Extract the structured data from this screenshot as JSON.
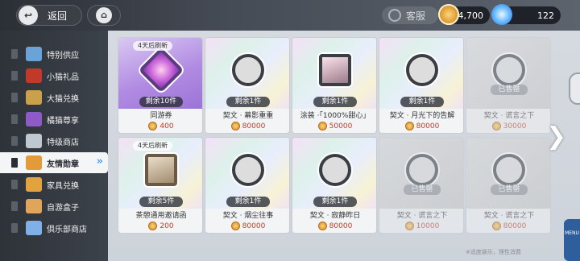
{
  "topbar": {
    "back_label": "返回",
    "service_label": "客服",
    "coins": "24,700",
    "gems": "122"
  },
  "sidebar": {
    "items": [
      {
        "label": "特别供应",
        "icon": "syringe-icon",
        "color": "#6aa3d8"
      },
      {
        "label": "小猫礼品",
        "icon": "ticket-icon",
        "color": "#c0392b"
      },
      {
        "label": "大猫兑换",
        "icon": "gold-ticket-icon",
        "color": "#caa04a"
      },
      {
        "label": "橘猫尊享",
        "icon": "purple-ticket-icon",
        "color": "#8e5ac8"
      },
      {
        "label": "特级商店",
        "icon": "diamond-icon",
        "color": "#bfc7d0"
      },
      {
        "label": "友情勋章",
        "icon": "medal-icon",
        "color": "#e39b3a",
        "active": true
      },
      {
        "label": "家具兑换",
        "icon": "coin-icon",
        "color": "#e2a33e"
      },
      {
        "label": "自游盒子",
        "icon": "box-icon",
        "color": "#e0a45a"
      },
      {
        "label": "俱乐部商店",
        "icon": "club-coin-icon",
        "color": "#7fb1e6"
      }
    ]
  },
  "shop": {
    "cards": [
      {
        "name": "同游券",
        "price": "400",
        "remain": "剩余10件",
        "refresh": "4天后刷新",
        "style": "purple",
        "icon": "heart-ticket-icon"
      },
      {
        "name": "契文 · 幕影重重",
        "price": "80000",
        "remain": "剩余1件",
        "style": "holo",
        "icon": "emblem-icon"
      },
      {
        "name": "涂装 ·「1000%甜心」",
        "price": "50000",
        "remain": "剩余1件",
        "style": "holo",
        "icon": "photo-cards-icon"
      },
      {
        "name": "契文 · 月光下的告解",
        "price": "80000",
        "remain": "剩余1件",
        "style": "holo",
        "icon": "emblem-icon"
      },
      {
        "name": "契文 · 谎言之下",
        "price": "30000",
        "sold": "已售罄",
        "style": "grey",
        "icon": "sleep-emblem-icon"
      },
      {
        "name": "茶憩通用邀请函",
        "price": "200",
        "remain": "剩余5件",
        "refresh": "4天后刷新",
        "style": "holo",
        "icon": "envelope-icon"
      },
      {
        "name": "契文 · 烟尘往事",
        "price": "80000",
        "remain": "剩余1件",
        "style": "holo",
        "icon": "emblem-icon"
      },
      {
        "name": "契文 · 寂静昨日",
        "price": "80000",
        "remain": "剩余1件",
        "style": "holo",
        "icon": "emblem-icon"
      },
      {
        "name": "契文 · 谎言之下",
        "price": "10000",
        "sold": "已售罄",
        "style": "grey",
        "icon": "sleep-emblem-icon"
      },
      {
        "name": "契文 · 谎言之下",
        "price": "80000",
        "sold": "已售罄",
        "style": "grey",
        "icon": "sleep-emblem-icon"
      }
    ]
  },
  "menu_label": "MENU",
  "footnote": "※适度娱乐，理性消费"
}
